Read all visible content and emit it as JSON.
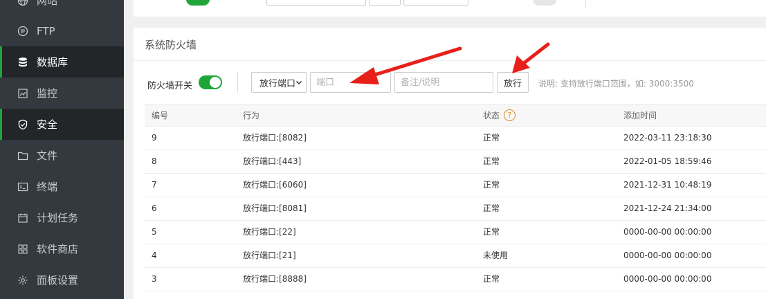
{
  "sidebar": {
    "items": [
      {
        "label": "网站",
        "icon": "globe-icon"
      },
      {
        "label": "FTP",
        "icon": "ftp-icon"
      },
      {
        "label": "数据库",
        "icon": "database-icon"
      },
      {
        "label": "监控",
        "icon": "monitor-icon"
      },
      {
        "label": "安全",
        "icon": "shield-icon"
      },
      {
        "label": "文件",
        "icon": "folder-icon"
      },
      {
        "label": "终端",
        "icon": "terminal-icon"
      },
      {
        "label": "计划任务",
        "icon": "calendar-icon"
      },
      {
        "label": "软件商店",
        "icon": "apps-grid-icon"
      },
      {
        "label": "面板设置",
        "icon": "gear-icon"
      }
    ],
    "active": "安全"
  },
  "firewall": {
    "title": "系统防火墙",
    "switch_label": "防火墙开关",
    "switch_on": true,
    "action_select": "放行端口",
    "port_placeholder": "端口",
    "note_placeholder": "备注/说明",
    "allow_button": "放行",
    "hint": "说明: 支持放行端口范围，如: 3000:3500"
  },
  "table": {
    "headers": [
      "编号",
      "行为",
      "状态",
      "添加时间"
    ],
    "rows": [
      [
        "9",
        "放行端口:[8082]",
        "正常",
        "2022-03-11 23:18:30"
      ],
      [
        "8",
        "放行端口:[443]",
        "正常",
        "2022-01-05 18:59:46"
      ],
      [
        "7",
        "放行端口:[6060]",
        "正常",
        "2021-12-31 10:48:19"
      ],
      [
        "6",
        "放行端口:[8081]",
        "正常",
        "2021-12-24 21:34:00"
      ],
      [
        "5",
        "放行端口:[22]",
        "正常",
        "0000-00-00 00:00:00"
      ],
      [
        "4",
        "放行端口:[21]",
        "未使用",
        "0000-00-00 00:00:00"
      ],
      [
        "3",
        "放行端口:[8888]",
        "正常",
        "0000-00-00 00:00:00"
      ]
    ]
  },
  "colors": {
    "sidebar_bg": "#34393f",
    "active_accent": "#20a53a",
    "arrow": "#e8201a",
    "help_icon": "#e08a1e"
  }
}
